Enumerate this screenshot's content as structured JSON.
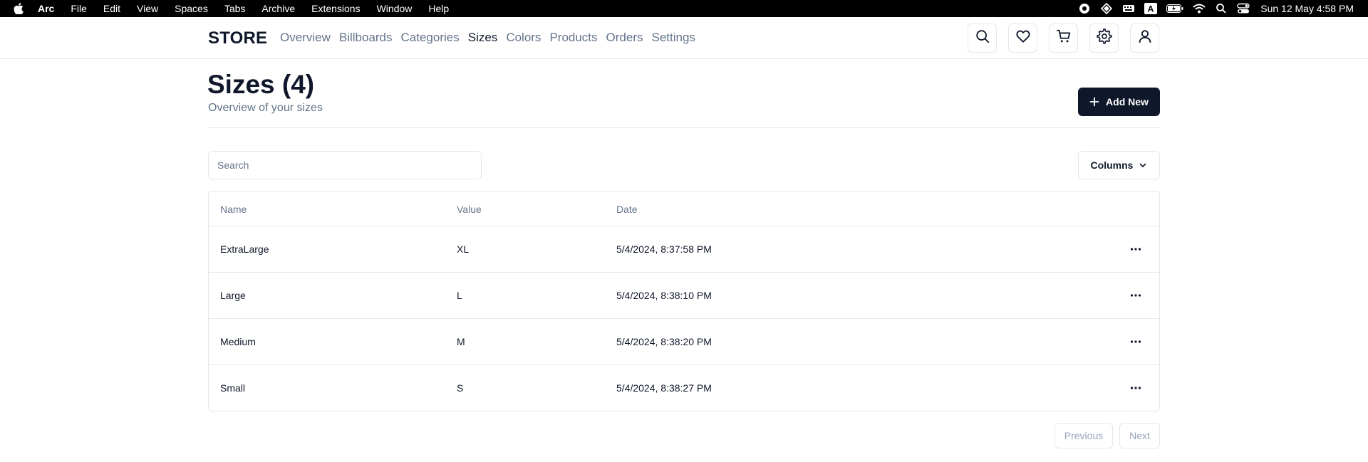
{
  "menubar": {
    "app_name": "Arc",
    "items": [
      "File",
      "Edit",
      "View",
      "Spaces",
      "Tabs",
      "Archive",
      "Extensions",
      "Window",
      "Help"
    ],
    "status_icons": [
      "screen-record-icon",
      "diamond-icon",
      "keyboard-brightness-icon",
      "input-source-icon",
      "battery-icon",
      "wifi-icon",
      "spotlight-search-icon",
      "control-center-icon"
    ],
    "input_source_letter": "A",
    "clock": "Sun 12 May  4:58 PM"
  },
  "nav": {
    "brand": "STORE",
    "links": [
      "Overview",
      "Billboards",
      "Categories",
      "Sizes",
      "Colors",
      "Products",
      "Orders",
      "Settings"
    ],
    "active": "Sizes",
    "action_icons": [
      "search-icon",
      "heart-icon",
      "cart-icon",
      "settings-icon",
      "user-icon"
    ]
  },
  "heading": {
    "title": "Sizes (4)",
    "subtitle": "Overview of your sizes",
    "add_label": "Add New"
  },
  "search": {
    "placeholder": "Search",
    "value": ""
  },
  "columns_button": {
    "label": "Columns"
  },
  "table": {
    "columns": [
      "Name",
      "Value",
      "Date"
    ],
    "rows": [
      {
        "name": "ExtraLarge",
        "value": "XL",
        "date": "5/4/2024, 8:37:58 PM"
      },
      {
        "name": "Large",
        "value": "L",
        "date": "5/4/2024, 8:38:10 PM"
      },
      {
        "name": "Medium",
        "value": "M",
        "date": "5/4/2024, 8:38:20 PM"
      },
      {
        "name": "Small",
        "value": "S",
        "date": "5/4/2024, 8:38:27 PM"
      }
    ]
  },
  "pagination": {
    "previous": "Previous",
    "next": "Next"
  },
  "colors": {
    "primary": "#0f172a",
    "muted_text": "#64748b",
    "border": "#e5e7eb",
    "disabled_text": "#94a3b8"
  }
}
